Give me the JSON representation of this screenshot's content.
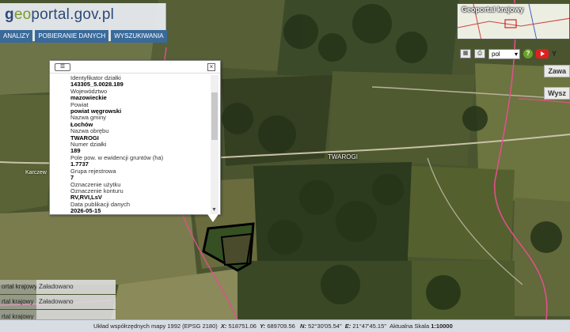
{
  "header": {
    "logo_prefix": "g",
    "logo_highlight": "eo",
    "logo_suffix": "portal.gov.pl",
    "menu": [
      "ANALIZY",
      "POBIERANIE DANYCH",
      "WYSZUKIWANIA"
    ]
  },
  "minimap": {
    "title": "Geoportal krajowy"
  },
  "toolbar": {
    "language": "pol",
    "help_label": "?",
    "youtube_label": "Y"
  },
  "side_buttons": [
    "Zawa",
    "Wysz"
  ],
  "popup": {
    "rows": [
      {
        "label": "Identyfikator działki",
        "value": "143305_5.0028.189"
      },
      {
        "label": "Województwo",
        "value": "mazowieckie"
      },
      {
        "label": "Powiat",
        "value": "powiat węgrowski"
      },
      {
        "label": "Nazwa gminy",
        "value": "Łochów"
      },
      {
        "label": "Nazwa obrębu",
        "value": "TWAROGI"
      },
      {
        "label": "Numer działki",
        "value": "189"
      },
      {
        "label": "Pole pow. w ewidencji gruntów (ha)",
        "value": "1.7737"
      },
      {
        "label": "Grupa rejestrowa",
        "value": "7"
      },
      {
        "label": "Oznaczenie użytku",
        "value": ""
      },
      {
        "label": "Oznaczenie konturu",
        "value": "RV,RVI,LsV"
      },
      {
        "label": "Data publikacji danych",
        "value": "2026-05-15"
      }
    ]
  },
  "map_labels": {
    "village": "TWAROGI",
    "west": "Karczew"
  },
  "layers": [
    {
      "name": "ortal krajowy",
      "status": "Załadowano"
    },
    {
      "name": "rtal krajowy",
      "status": "Załadowano"
    },
    {
      "name": "rtal krajowy",
      "status": ""
    }
  ],
  "status_bar": {
    "system": "Układ współrzędnych mapy 1992 (EPSG 2180)",
    "x_label": "X:",
    "x_value": "518751.06",
    "y_label": "Y:",
    "y_value": "689709.56",
    "n_label": "N:",
    "n_value": "52°30'05.54\"",
    "e_label": "E:",
    "e_value": "21°47'45.15\"",
    "scale_label": "Aktualna Skala",
    "scale_value": "1:10000"
  },
  "colors": {
    "boundary": "#e0508a",
    "parcel_fill": "#2d4a1e",
    "parcel_outline": "#000000",
    "menu_bg": "#3a6a9a"
  }
}
